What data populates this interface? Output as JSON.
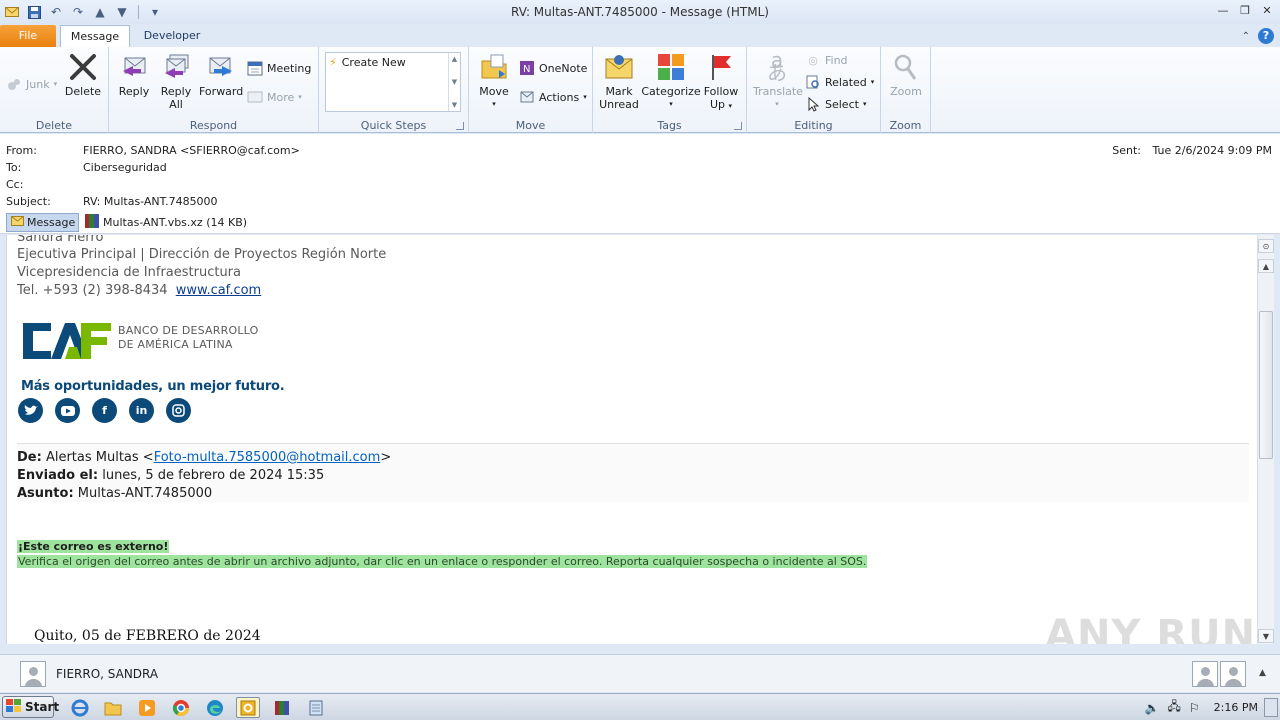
{
  "window": {
    "title": "RV: Multas-ANT.7485000  -  Message (HTML)"
  },
  "tabs": [
    {
      "label": "File"
    },
    {
      "label": "Message"
    },
    {
      "label": "Developer"
    }
  ],
  "ribbon": {
    "delete_group": {
      "label": "Delete",
      "junk": "Junk",
      "delete": "Delete"
    },
    "respond_group": {
      "label": "Respond",
      "reply": "Reply",
      "reply_all_1": "Reply",
      "reply_all_2": "All",
      "forward": "Forward",
      "meeting": "Meeting",
      "more": "More"
    },
    "quicksteps_group": {
      "label": "Quick Steps",
      "create_new": "Create New"
    },
    "move_group": {
      "label": "Move",
      "move": "Move",
      "onenote": "OneNote",
      "actions": "Actions"
    },
    "tags_group": {
      "label": "Tags",
      "mark_unread_1": "Mark",
      "mark_unread_2": "Unread",
      "categorize": "Categorize",
      "follow_up_1": "Follow",
      "follow_up_2": "Up"
    },
    "editing_group": {
      "label": "Editing",
      "translate": "Translate",
      "find": "Find",
      "related": "Related",
      "select": "Select"
    },
    "zoom_group": {
      "label": "Zoom",
      "zoom": "Zoom"
    }
  },
  "header": {
    "from_label": "From:",
    "from_value": "FIERRO, SANDRA <SFIERRO@caf.com>",
    "to_label": "To:",
    "to_value": "Ciberseguridad",
    "cc_label": "Cc:",
    "cc_value": "",
    "subject_label": "Subject:",
    "subject_value": "RV: Multas-ANT.7485000",
    "sent_label": "Sent:",
    "sent_value": "Tue 2/6/2024 9:09 PM"
  },
  "attachments": {
    "message_tab": "Message",
    "file_name": "Multas-ANT.vbs.xz (14 KB)"
  },
  "body": {
    "sig_name": "Sandra Fierro",
    "sig_title": "Ejecutiva Principal | Dirección de Proyectos Región Norte",
    "sig_dept": "Vicepresidencia de Infraestructura",
    "sig_phone": "Tel. +593 (2) 398-8434",
    "sig_web": "www.caf.com",
    "logo_line1": "BANCO DE DESARROLLO",
    "logo_line2": "DE AMÉRICA LATINA",
    "tagline": "Más oportunidades, un mejor futuro.",
    "fwd_de_label": "De:",
    "fwd_de_name": "Alertas Multas <",
    "fwd_de_email": "Foto-multa.7585000@hotmail.com",
    "fwd_de_close": ">",
    "fwd_enviado_label": "Enviado el:",
    "fwd_enviado_value": "lunes, 5 de febrero de 2024 15:35",
    "fwd_asunto_label": "Asunto:",
    "fwd_asunto_value": "Multas-ANT.7485000",
    "external_title": "¡Este correo es externo!",
    "external_text": "Verifica el origen del correo antes de abrir un archivo adjunto, dar clic en un enlace o responder el correo. Reporta cualquier sospecha o incidente al SOS.",
    "quito_line": "Quito, 05 de FEBRERO de 2024",
    "watermark": "ANY RUN"
  },
  "people_pane": {
    "name": "FIERRO, SANDRA"
  },
  "taskbar": {
    "start": "Start",
    "clock": "2:16 PM"
  },
  "colors": {
    "caf_blue": "#0c4a7a",
    "caf_green": "#7ab800",
    "external_highlight": "#9ee39e",
    "file_tab": "#e7800d"
  }
}
